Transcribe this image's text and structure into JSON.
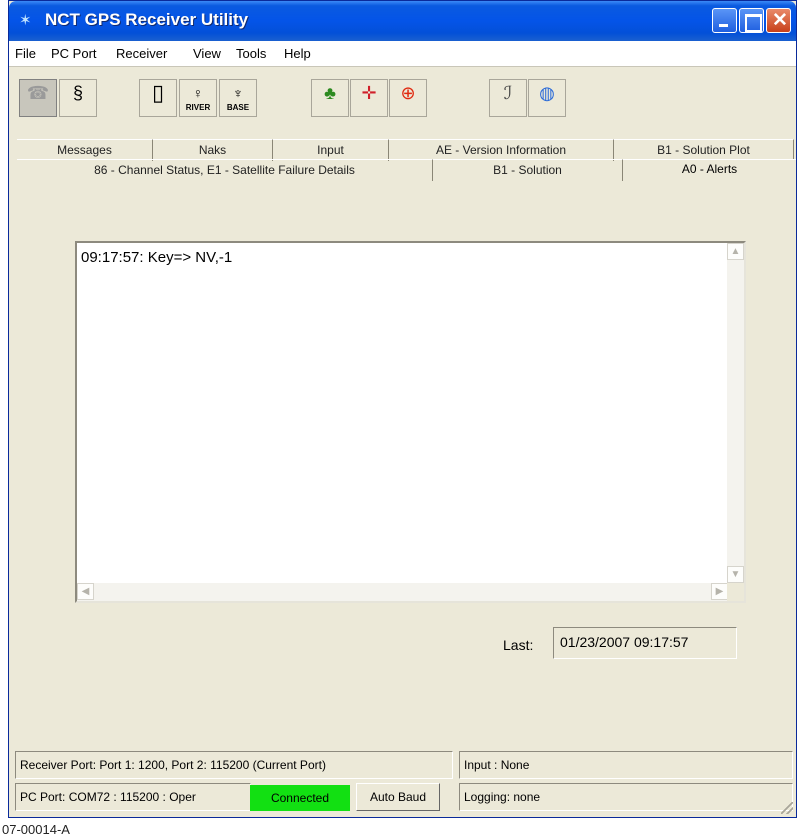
{
  "window": {
    "title": "NCT GPS Receiver Utility"
  },
  "menu": [
    "File",
    "PC Port",
    "Receiver",
    "View",
    "Tools",
    "Help"
  ],
  "toolbar": {
    "river_caption": "RIVER",
    "base_caption": "BASE"
  },
  "tabs_row1": [
    "Messages",
    "Naks",
    "Input",
    "AE - Version Information",
    "B1 - Solution Plot"
  ],
  "tabs_row2": [
    "86 - Channel Status, E1 - Satellite Failure Details",
    "B1 - Solution",
    "A0 - Alerts"
  ],
  "active_tab": "A0 - Alerts",
  "log": {
    "lines": [
      "09:17:57: Key=> NV,-1"
    ]
  },
  "last": {
    "label": "Last:",
    "value": "01/23/2007 09:17:57"
  },
  "status": {
    "receiver_port_label": "Receiver Port:",
    "receiver_port_value": "Port 1: 1200, Port 2: 115200 (Current Port)",
    "input": "Input : None",
    "pc_port_label": "PC Port:",
    "pc_port_value": "COM72 : 115200 : Oper",
    "connected": "Connected",
    "autobaud": "Auto Baud",
    "logging": "Logging: none",
    "connected_color": "#12e012"
  },
  "caption": "07-00014-A"
}
